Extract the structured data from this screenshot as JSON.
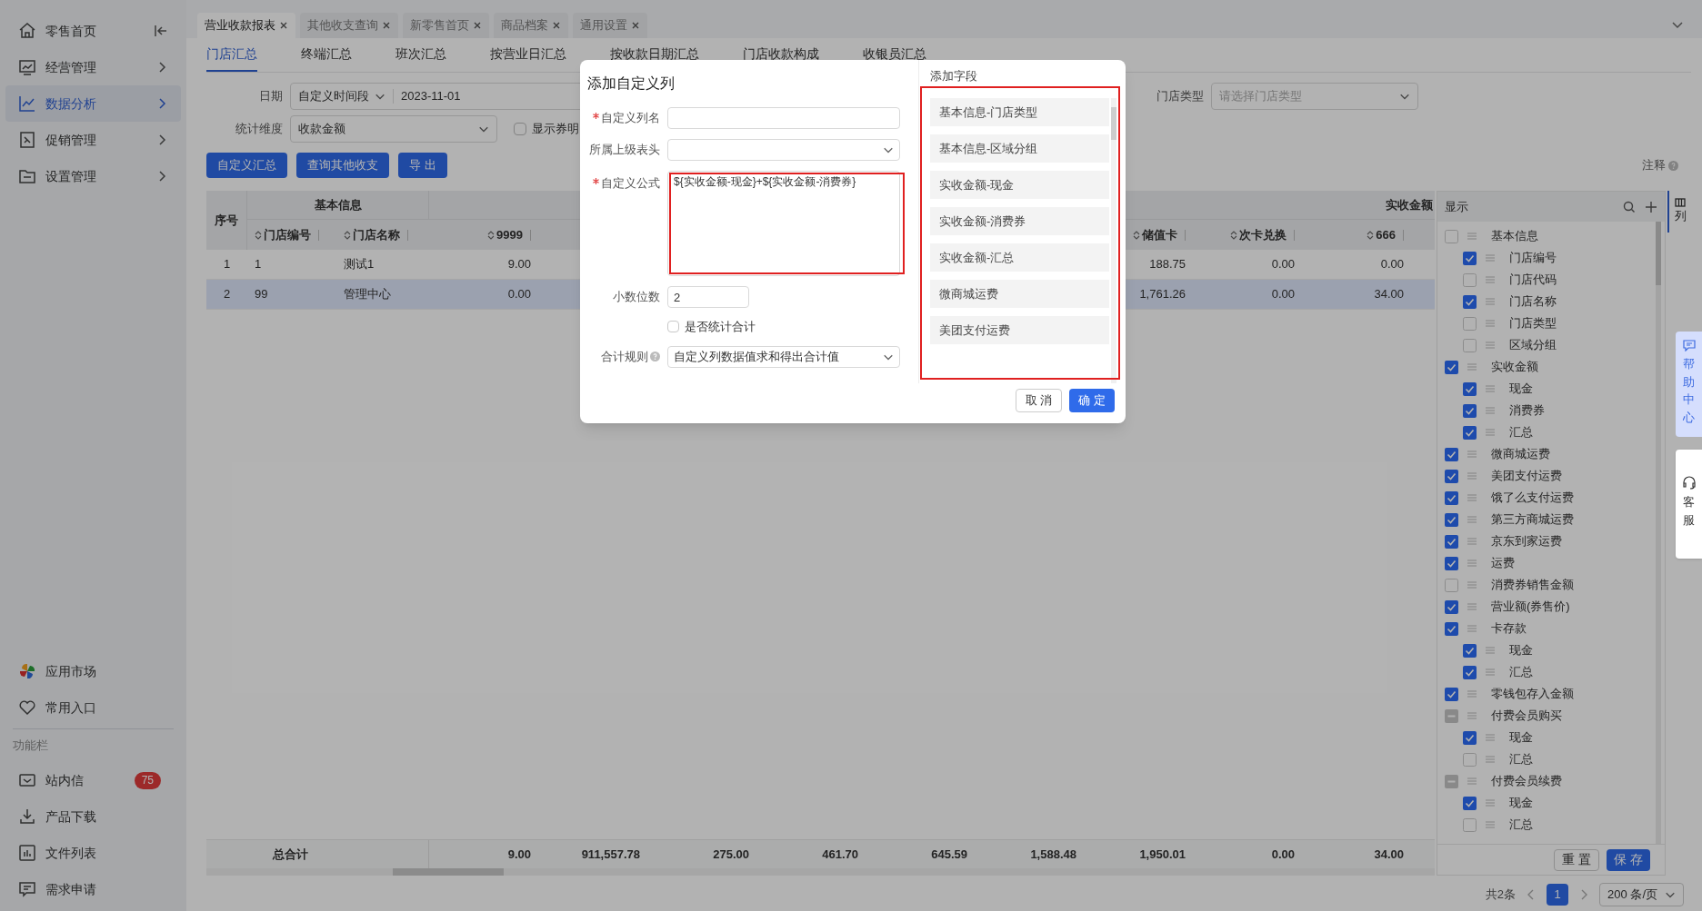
{
  "sidebar": {
    "nav": [
      {
        "label": "零售首页",
        "kind": "home",
        "selected": false
      },
      {
        "label": "经营管理",
        "kind": "submenu",
        "selected": false
      },
      {
        "label": "数据分析",
        "kind": "submenu",
        "selected": true
      },
      {
        "label": "促销管理",
        "kind": "submenu",
        "selected": false
      },
      {
        "label": "设置管理",
        "kind": "submenu",
        "selected": false
      }
    ],
    "apps": [
      {
        "label": "应用市场"
      },
      {
        "label": "常用入口"
      }
    ],
    "section_label": "功能栏",
    "tools": [
      {
        "label": "站内信",
        "badge": "75"
      },
      {
        "label": "产品下载"
      },
      {
        "label": "文件列表"
      },
      {
        "label": "需求申请"
      }
    ]
  },
  "tabs": [
    {
      "label": "营业收款报表",
      "selected": true
    },
    {
      "label": "其他收支查询",
      "selected": false
    },
    {
      "label": "新零售首页",
      "selected": false
    },
    {
      "label": "商品档案",
      "selected": false
    },
    {
      "label": "通用设置",
      "selected": false
    }
  ],
  "sub_tabs": [
    {
      "label": "门店汇总",
      "selected": true
    },
    {
      "label": "终端汇总",
      "selected": false
    },
    {
      "label": "班次汇总",
      "selected": false
    },
    {
      "label": "按营业日汇总",
      "selected": false
    },
    {
      "label": "按收款日期汇总",
      "selected": false
    },
    {
      "label": "门店收款构成",
      "selected": false
    },
    {
      "label": "收银员汇总",
      "selected": false
    }
  ],
  "filters": {
    "date_label": "日期",
    "date_mode": "自定义时间段",
    "date_start": "2023-11-01",
    "dimension_label": "统计维度",
    "dimension": "收款金额",
    "show_coupon": {
      "label": "显示券明",
      "checked": false
    },
    "store_type_label": "门店类型",
    "store_type": {
      "placeholder": "请选择门店类型"
    }
  },
  "actions": [
    {
      "label": "自定义汇总"
    },
    {
      "label": "查询其他收支"
    },
    {
      "label": "导 出"
    }
  ],
  "note": "注释",
  "table": {
    "groups": [
      "基本信息",
      "实收金额"
    ],
    "columns": [
      {
        "label": "序号",
        "sortable": false
      },
      {
        "label": "门店编号",
        "sortable": true
      },
      {
        "label": "门店名称",
        "sortable": true
      },
      {
        "label": "9999",
        "sortable": true
      },
      {
        "label": "储值卡",
        "sortable": true
      },
      {
        "label": "次卡兑换",
        "sortable": true
      },
      {
        "label": "666",
        "sortable": true
      }
    ],
    "rows": [
      {
        "cells": [
          "1",
          "1",
          "测试1",
          "9.00",
          "188.75",
          "0.00",
          "0.00"
        ],
        "selected": false
      },
      {
        "cells": [
          "2",
          "99",
          "管理中心",
          "0.00",
          "1,761.26",
          "0.00",
          "34.00"
        ],
        "selected": true
      }
    ],
    "total": {
      "label": "总合计",
      "values": [
        "9.00",
        "911,557.78",
        "275.00",
        "461.70",
        "645.59",
        "1,588.48",
        "1,950.01",
        "0.00",
        "34.00"
      ]
    }
  },
  "column_panel": {
    "title": "显示",
    "tab_label": "列",
    "items": [
      {
        "label": "基本信息",
        "checked": false,
        "indeterminate": false,
        "children": [
          {
            "label": "门店编号",
            "checked": true
          },
          {
            "label": "门店代码",
            "checked": false
          },
          {
            "label": "门店名称",
            "checked": true
          },
          {
            "label": "门店类型",
            "checked": false
          },
          {
            "label": "区域分组",
            "checked": false
          }
        ]
      },
      {
        "label": "实收金额",
        "checked": true,
        "indeterminate": false,
        "children": [
          {
            "label": "现金",
            "checked": true
          },
          {
            "label": "消费券",
            "checked": true
          },
          {
            "label": "汇总",
            "checked": true
          }
        ]
      },
      {
        "label": "微商城运费",
        "checked": true,
        "indeterminate": false
      },
      {
        "label": "美团支付运费",
        "checked": true,
        "indeterminate": false
      },
      {
        "label": "饿了么支付运费",
        "checked": true,
        "indeterminate": false
      },
      {
        "label": "第三方商城运费",
        "checked": true,
        "indeterminate": false
      },
      {
        "label": "京东到家运费",
        "checked": true,
        "indeterminate": false
      },
      {
        "label": "运费",
        "checked": true,
        "indeterminate": false
      },
      {
        "label": "消费券销售金额",
        "checked": false,
        "indeterminate": false
      },
      {
        "label": "营业额(券售价)",
        "checked": true,
        "indeterminate": false
      },
      {
        "label": "卡存款",
        "checked": true,
        "indeterminate": false,
        "children": [
          {
            "label": "现金",
            "checked": true
          },
          {
            "label": "汇总",
            "checked": true
          }
        ]
      },
      {
        "label": "零钱包存入金额",
        "checked": true,
        "indeterminate": false
      },
      {
        "label": "付费会员购买",
        "checked": false,
        "indeterminate": true,
        "children": [
          {
            "label": "现金",
            "checked": true
          },
          {
            "label": "汇总",
            "checked": false
          }
        ]
      },
      {
        "label": "付费会员续费",
        "checked": false,
        "indeterminate": true,
        "children": [
          {
            "label": "现金",
            "checked": true
          },
          {
            "label": "汇总",
            "checked": false
          }
        ]
      }
    ],
    "buttons": [
      {
        "label": "重 置",
        "kind": "default"
      },
      {
        "label": "保 存",
        "kind": "primary"
      }
    ]
  },
  "pagination": {
    "total": "共2条",
    "pages": [
      {
        "label": "1",
        "selected": true
      }
    ],
    "page_size": "200 条/页"
  },
  "float_tabs": [
    {
      "label": "帮助中心",
      "kind": "help"
    },
    {
      "label": "客服",
      "kind": "service"
    }
  ],
  "modal": {
    "title": "添加自定义列",
    "fields": [
      {
        "kind": "text",
        "label": "自定义列名",
        "required": true
      },
      {
        "kind": "select",
        "label": "所属上级表头",
        "required": false
      },
      {
        "kind": "textarea",
        "label": "自定义公式",
        "required": true,
        "value": "${实收金额-现金}+${实收金额-消费券}"
      },
      {
        "kind": "number",
        "label": "小数位数",
        "required": false,
        "value": "2"
      },
      {
        "kind": "checkbox",
        "label": "是否统计合计",
        "checked": false
      },
      {
        "kind": "select",
        "label": "合计规则",
        "required": false,
        "help": true,
        "value": "自定义列数据值求和得出合计值"
      }
    ],
    "field_panel": {
      "title": "添加字段",
      "items": [
        "基本信息-门店类型",
        "基本信息-区域分组",
        "实收金额-现金",
        "实收金额-消费券",
        "实收金额-汇总",
        "微商城运费",
        "美团支付运费"
      ]
    },
    "buttons": [
      {
        "label": "取 消",
        "kind": "default"
      },
      {
        "label": "确 定",
        "kind": "primary"
      }
    ]
  }
}
